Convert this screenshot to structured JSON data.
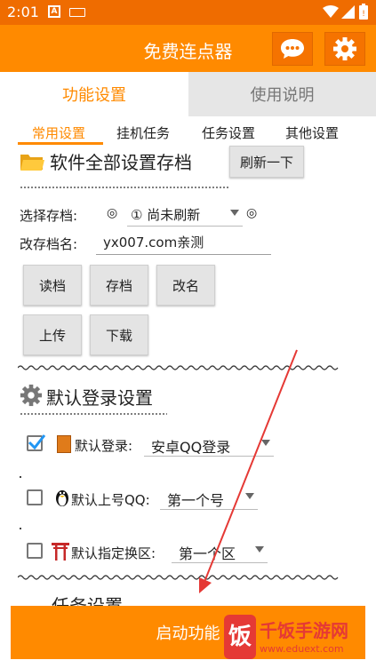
{
  "status": {
    "time": "2:01"
  },
  "appbar": {
    "title": "免费连点器",
    "chat_icon": "chat-bubble-icon",
    "settings_icon": "gear-icon"
  },
  "main_tabs": [
    {
      "label": "功能设置",
      "active": true
    },
    {
      "label": "使用说明",
      "active": false
    }
  ],
  "sub_tabs": [
    {
      "label": "常用设置",
      "active": true
    },
    {
      "label": "挂机任务"
    },
    {
      "label": "任务设置"
    },
    {
      "label": "其他设置"
    }
  ],
  "save_section": {
    "title": "软件全部设置存档",
    "refresh_label": "刷新一下",
    "select_label": "选择存档:",
    "select_value": "① 尚未刷新",
    "rename_label": "改存档名:",
    "rename_value": "yx007.com亲测",
    "buttons": [
      "读档",
      "存档",
      "改名",
      "上传",
      "下载"
    ]
  },
  "login_section": {
    "title": "默认登录设置",
    "rows": [
      {
        "label": "默认登录:",
        "value": "安卓QQ登录",
        "checked": true
      },
      {
        "label": "默认上号QQ:",
        "value": "第一个号",
        "checked": false
      },
      {
        "label": "默认指定换区:",
        "value": "第一个区",
        "checked": false
      }
    ],
    "next_title_partial": "任务设置"
  },
  "start_button": {
    "label": "启动功能"
  },
  "watermark": {
    "brand": "千饭手游网",
    "url": "www.eduext.com"
  },
  "colors": {
    "accent": "#ff8a00",
    "statusbar": "#ef6c00"
  }
}
